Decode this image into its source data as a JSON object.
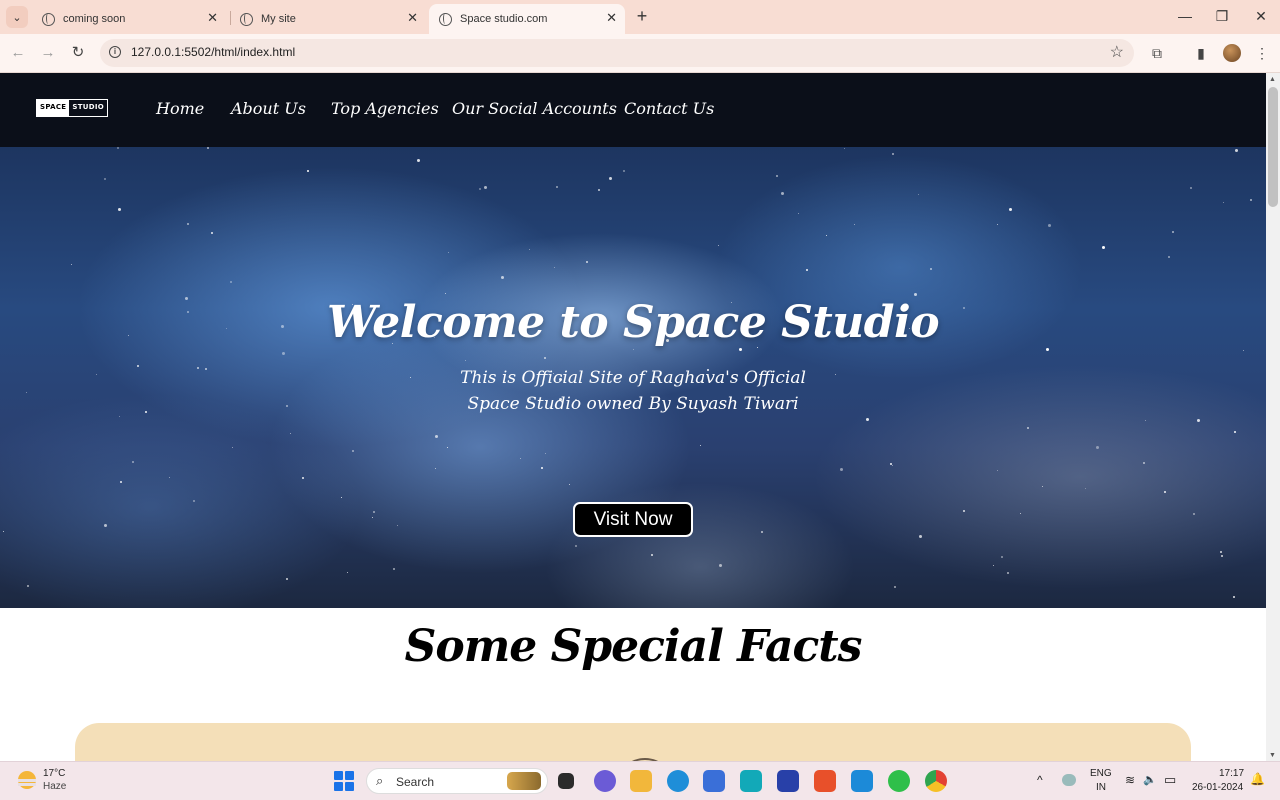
{
  "browser": {
    "tabs": [
      {
        "title": "coming soon",
        "active": false
      },
      {
        "title": "My site",
        "active": false
      },
      {
        "title": "Space studio.com",
        "active": true
      }
    ],
    "url": "127.0.0.1:5502/html/index.html",
    "tab_close_glyph": "✕",
    "new_tab_glyph": "+",
    "window_controls": {
      "minimize": "—",
      "maximize": "❐",
      "close": "✕"
    },
    "nav_icons": {
      "back": "←",
      "forward": "→",
      "reload": "↻"
    },
    "bookmark_glyph": "☆",
    "extension_glyph": "⧉",
    "sidepanel_glyph": "▮",
    "menu_glyph": "⋮",
    "tab_list_glyph": "⌄"
  },
  "site": {
    "logo": {
      "part1": "SPACE",
      "part2": "STUDIO"
    },
    "nav": [
      "Home",
      "About Us",
      "Top Agencies",
      "Our Social Accounts",
      "Contact Us"
    ],
    "hero": {
      "title": "Welcome to Space Studio",
      "subtitle": "This is Official Site of Raghava's Official Space Studio owned By Suyash Tiwari",
      "button": "Visit Now"
    },
    "facts_title": "Some Special Facts",
    "facts_card_color": "#f4dfb8"
  },
  "taskbar": {
    "weather": {
      "temp": "17°C",
      "condition": "Haze"
    },
    "search_placeholder": "Search",
    "search_glyph": "⌕",
    "tray_chevron": "^",
    "language": {
      "line1": "ENG",
      "line2": "IN"
    },
    "tray_icons": {
      "wifi": "≋",
      "volume": "🔈",
      "battery": "▭",
      "notification": "🔔"
    },
    "time": "17:17",
    "date": "26-01-2024"
  }
}
